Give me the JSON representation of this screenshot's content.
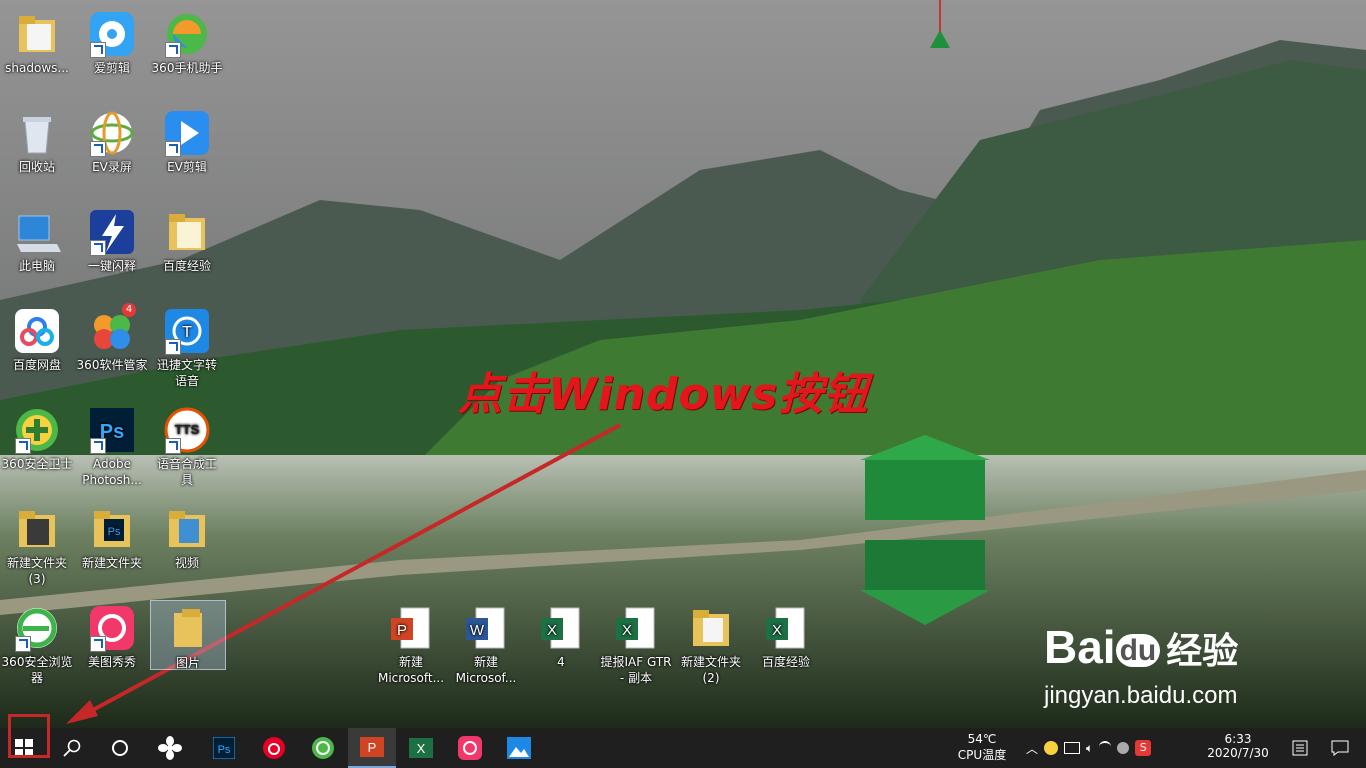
{
  "desktop_icons": {
    "col1": [
      {
        "label": "shadows..."
      },
      {
        "label": "回收站"
      },
      {
        "label": "此电脑"
      },
      {
        "label": "百度网盘"
      },
      {
        "label": "360安全卫士"
      },
      {
        "label": "新建文件夹\n(3)"
      },
      {
        "label": "360安全浏览\n器"
      }
    ],
    "col2": [
      {
        "label": "爱剪辑"
      },
      {
        "label": "EV录屏"
      },
      {
        "label": "一键闪释"
      },
      {
        "label": "360软件管家",
        "badge": "4"
      },
      {
        "label": "Adobe\nPhotosh..."
      },
      {
        "label": "新建文件夹"
      },
      {
        "label": "美图秀秀"
      }
    ],
    "col3": [
      {
        "label": "360手机助手"
      },
      {
        "label": "EV剪辑"
      },
      {
        "label": "百度经验"
      },
      {
        "label": "迅捷文字转\n语音"
      },
      {
        "label": "语音合成工\n具",
        "icon_text": "TTS"
      },
      {
        "label": "视频"
      },
      {
        "label": "图片"
      }
    ],
    "bottom_row": [
      {
        "label": "新建\nMicrosoft..."
      },
      {
        "label": "新建\nMicrosof..."
      },
      {
        "label": "4"
      },
      {
        "label": "提报IAF GTR\n- 副本"
      },
      {
        "label": "新建文件夹\n(2)"
      },
      {
        "label": "百度经验"
      }
    ]
  },
  "annotation": {
    "text": "点击Windows按钮",
    "color": "#e3161b"
  },
  "watermark": {
    "brand_a": "Bai",
    "brand_b": "du",
    "brand_cn": "经验",
    "url": "jingyan.baidu.com"
  },
  "taskbar": {
    "apps": [
      "start-icon",
      "search-icon",
      "cortana-icon",
      "pinwheel-icon",
      "photoshop-icon",
      "netease-music-icon",
      "browser-icon",
      "powerpoint-icon",
      "excel-icon",
      "meitu-icon",
      "photos-icon"
    ],
    "cpu_temp": "54℃",
    "cpu_label": "CPU温度",
    "time": "6:33",
    "date": "2020/7/30"
  },
  "colors": {
    "taskbar": "#1f1f1f",
    "annotation": "#e3161b",
    "ps_blue": "#31a8ff",
    "excel_green": "#1d7044",
    "ppt_orange": "#d04423"
  }
}
